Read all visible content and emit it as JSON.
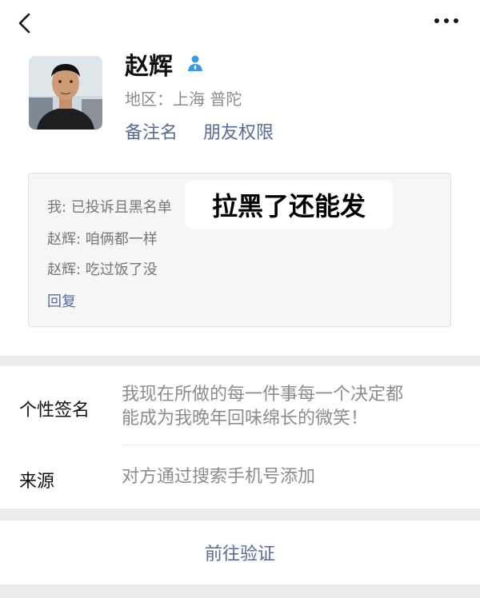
{
  "profile": {
    "name": "赵辉",
    "region": "地区：上海 普陀",
    "remark_label": "备注名",
    "permission_label": "朋友权限"
  },
  "messages": {
    "lines": [
      "我: 已投诉且黑名单",
      "赵辉: 咱俩都一样",
      "赵辉: 吃过饭了没"
    ],
    "reply_label": "回复",
    "overlay_text": "拉黑了还能发"
  },
  "info": {
    "signature_label": "个性签名",
    "signature_line1": "我现在所做的每一件事每一个决定都",
    "signature_line2": "能成为我晚年回味绵长的微笑！",
    "source_label": "来源",
    "source_value": "对方通过搜索手机号添加"
  },
  "actions": {
    "verify_label": "前往验证"
  },
  "icons": {
    "back": "chevron-left-icon",
    "more": "more-dots-icon",
    "verified": "person-icon"
  },
  "colors": {
    "link": "#576b95",
    "secondary_text": "#8c8c8c",
    "page_background": "#ececec"
  }
}
